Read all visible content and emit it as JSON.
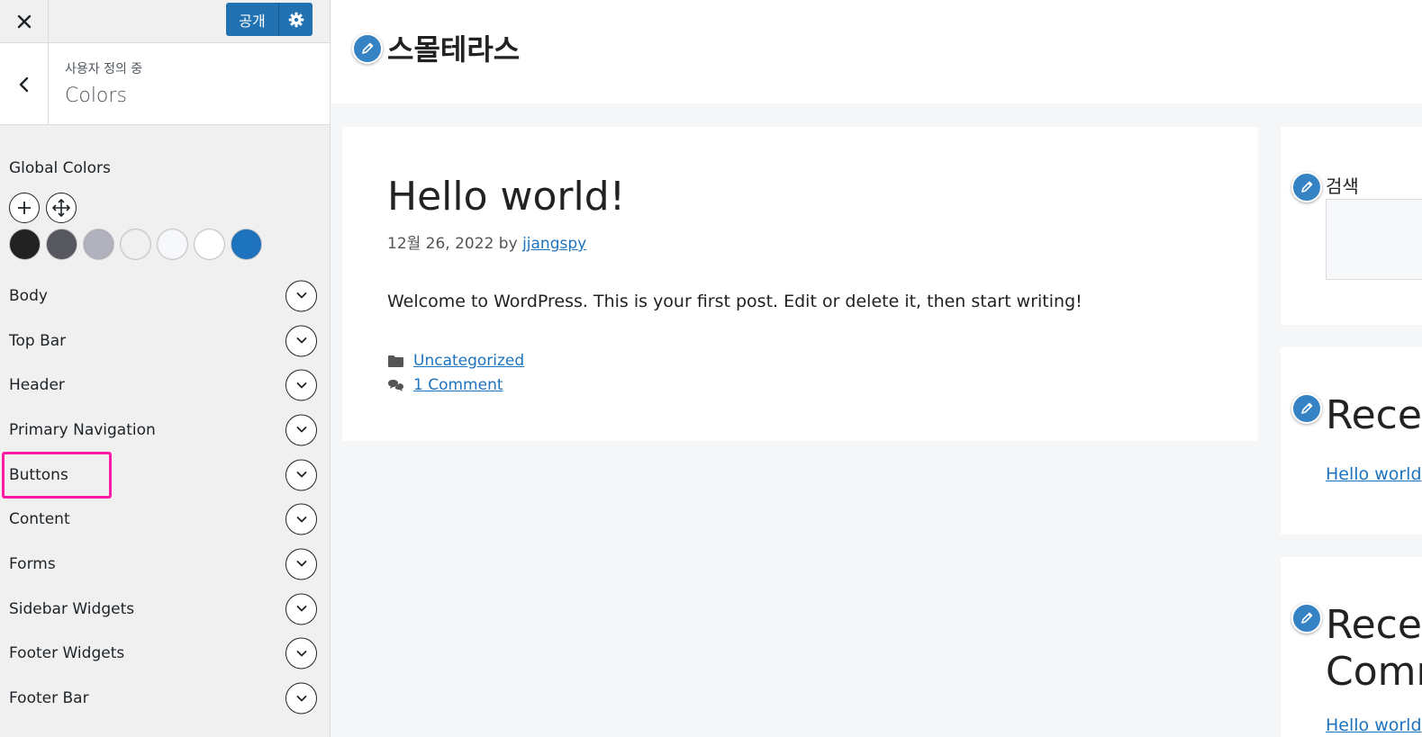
{
  "customizer": {
    "publish_label": "공개",
    "breadcrumb": "사용자 정의 중",
    "section_title": "Colors",
    "global_colors_label": "Global Colors",
    "global_colors": [
      "#222222",
      "#575760",
      "#b2b2be",
      "#f0f0f0",
      "#f7f8f9",
      "#ffffff",
      "#1e73be"
    ],
    "color_sections": [
      "Body",
      "Top Bar",
      "Header",
      "Primary Navigation",
      "Buttons",
      "Content",
      "Forms",
      "Sidebar Widgets",
      "Footer Widgets",
      "Footer Bar"
    ],
    "highlighted_section": "Buttons",
    "highlight_color": "#ff1aa3",
    "accent_color": "#2271b1"
  },
  "preview": {
    "site_title": "스몰테라스",
    "post": {
      "title": "Hello world!",
      "date": "12월 26, 2022",
      "by": "by",
      "author": "jjangspy",
      "body": "Welcome to WordPress. This is your first post. Edit or delete it, then start writing!",
      "category": "Uncategorized",
      "comments": "1 Comment"
    },
    "sidebar": {
      "search_title": "검색",
      "recent_posts_title": "Recen",
      "recent_posts_link": "Hello world",
      "recent_comments_title_line1": "Recen",
      "recent_comments_title_line2": "Comm",
      "recent_comments_link": "Hello world"
    },
    "link_color": "#1e73be",
    "edit_shortcut_color": "#3582c4"
  }
}
